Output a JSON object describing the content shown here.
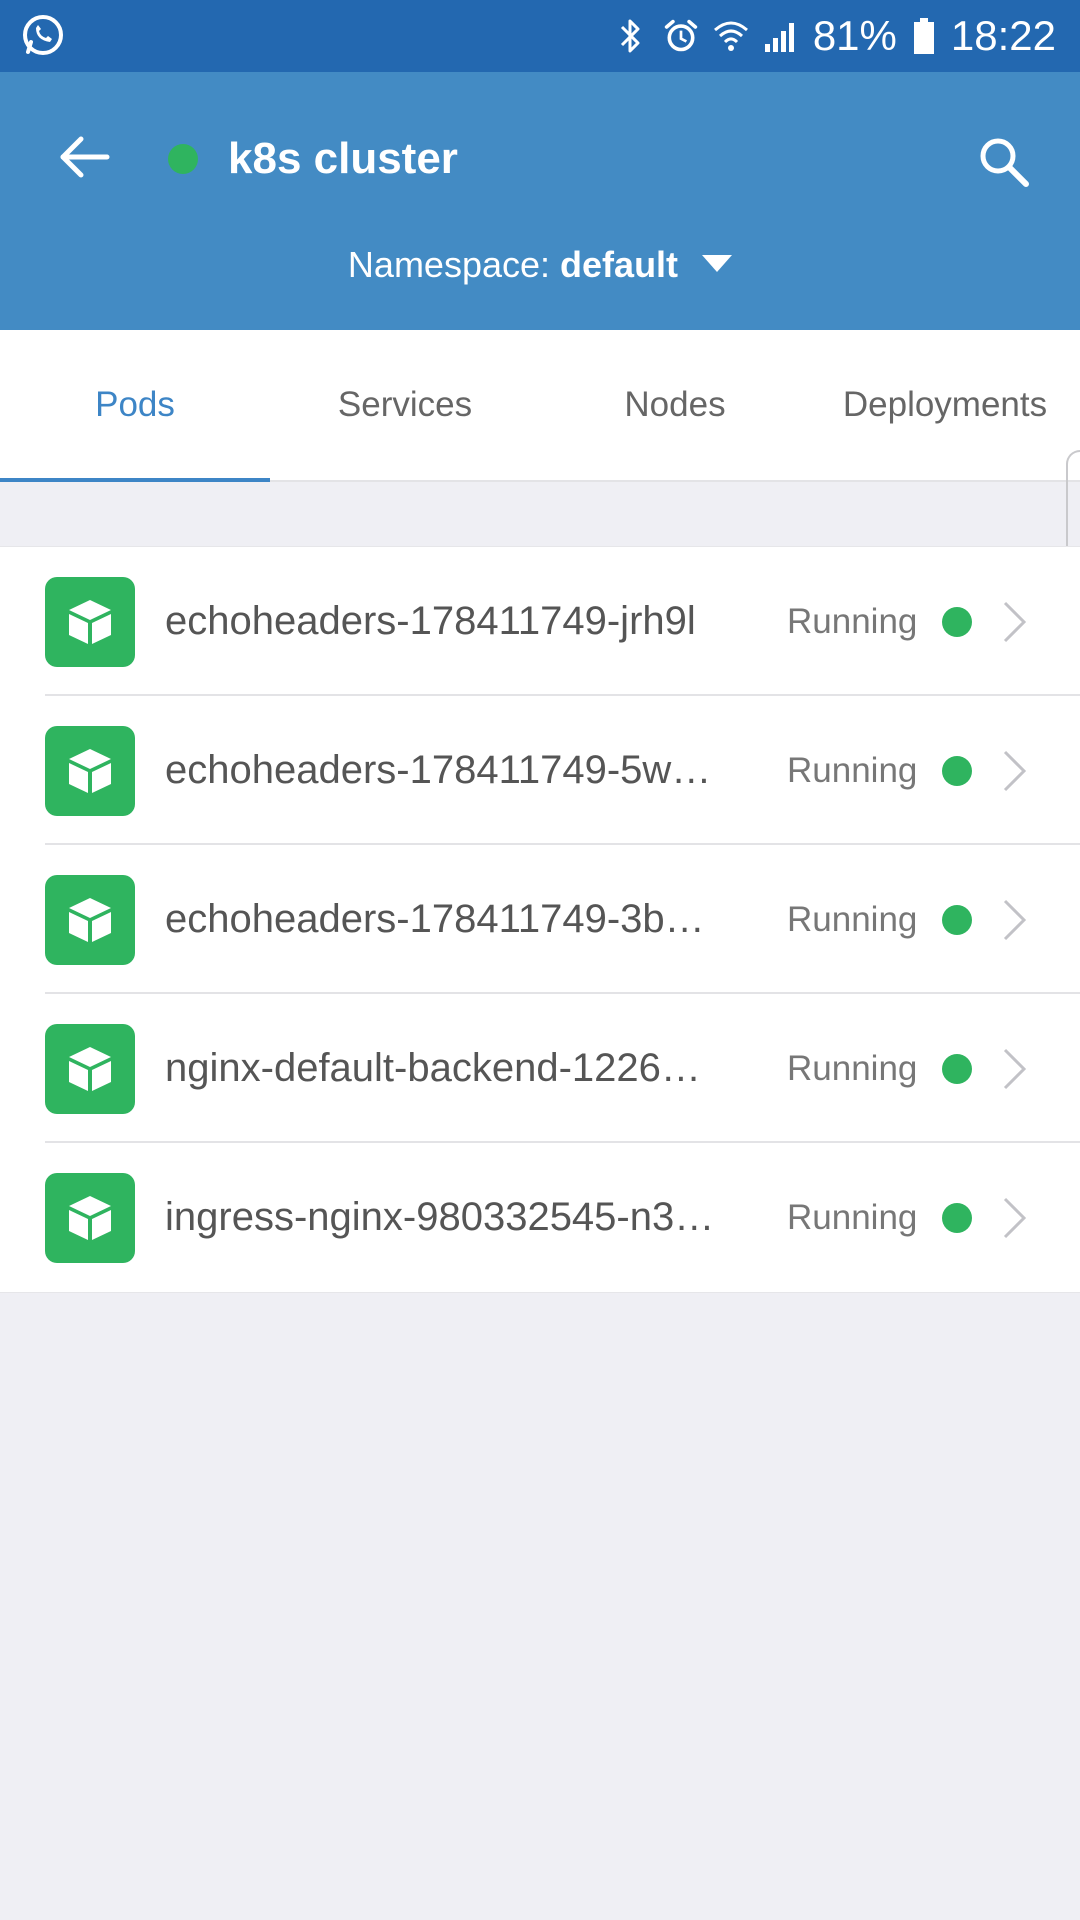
{
  "status_bar": {
    "left_icon": "whatsapp-icon",
    "icons": [
      "bluetooth-icon",
      "alarm-icon",
      "wifi-icon",
      "signal-icon"
    ],
    "battery_percent": "81%",
    "battery_icon": "battery-icon",
    "time": "18:22"
  },
  "header": {
    "back_icon": "arrow-left-icon",
    "connection_status_color": "#2fb45f",
    "title": "k8s cluster",
    "search_icon": "search-icon",
    "namespace_label": "Namespace:",
    "namespace_value": "default",
    "namespace_dropdown_icon": "caret-down-icon"
  },
  "tabs": [
    {
      "label": "Pods",
      "active": true
    },
    {
      "label": "Services",
      "active": false
    },
    {
      "label": "Nodes",
      "active": false
    },
    {
      "label": "Deployments",
      "active": false
    }
  ],
  "pods": [
    {
      "name": "echoheaders-178411749-jrh9l",
      "status": "Running",
      "status_color": "#2fb45f",
      "icon": "cube-icon"
    },
    {
      "name": "echoheaders-178411749-5w…",
      "status": "Running",
      "status_color": "#2fb45f",
      "icon": "cube-icon"
    },
    {
      "name": "echoheaders-178411749-3b…",
      "status": "Running",
      "status_color": "#2fb45f",
      "icon": "cube-icon"
    },
    {
      "name": "nginx-default-backend-1226…",
      "status": "Running",
      "status_color": "#2fb45f",
      "icon": "cube-icon"
    },
    {
      "name": "ingress-nginx-980332545-n3…",
      "status": "Running",
      "status_color": "#2fb45f",
      "icon": "cube-icon"
    }
  ],
  "colors": {
    "status_bar": "#2368b0",
    "app_bar": "#438bc4",
    "accent": "#3d85c6",
    "pod_icon_bg": "#2fb45f",
    "background": "#efeff4"
  }
}
